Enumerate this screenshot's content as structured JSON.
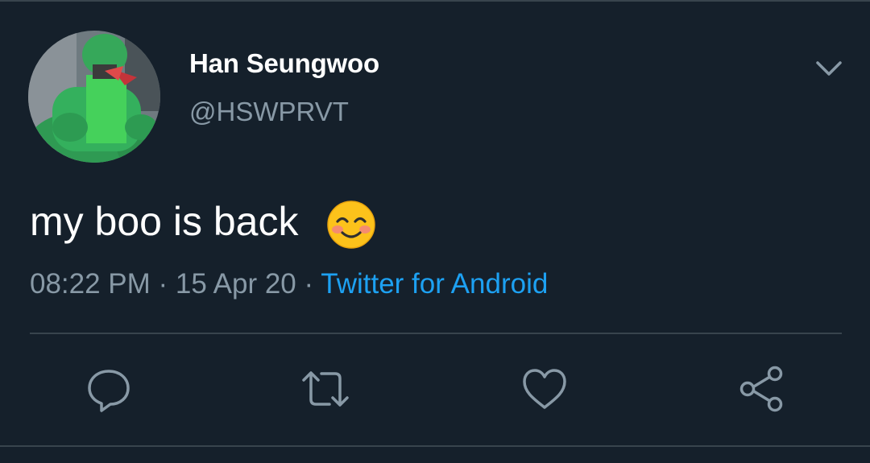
{
  "tweet": {
    "author": {
      "display_name": "Han Seungwoo",
      "handle": "@HSWPRVT"
    },
    "text": "my boo is back",
    "emoji": "smiling-face-with-smiling-eyes",
    "meta": {
      "time": "08:22 PM",
      "separator": " · ",
      "date": "15 Apr 20",
      "source": "Twitter for Android"
    }
  },
  "icons": {
    "more": "chevron-down-icon",
    "reply": "reply-icon",
    "retweet": "retweet-icon",
    "like": "heart-icon",
    "share": "share-icon"
  },
  "colors": {
    "background": "#15202b",
    "text_secondary": "#8899a6",
    "link": "#1da1f2",
    "divider": "#38444d"
  }
}
